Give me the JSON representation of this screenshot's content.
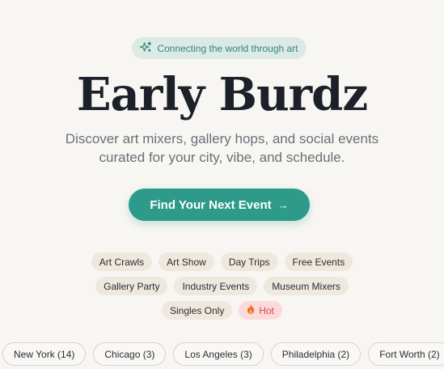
{
  "badge": {
    "text": "Connecting the world through art",
    "icon": "sparkle-icon"
  },
  "title": "Early Burdz",
  "subtitle": {
    "line1": "Discover art mixers, gallery hops, and social events",
    "line2": "curated for your city, vibe, and schedule."
  },
  "cta": {
    "label": "Find Your Next Event",
    "icon": "arrow-right-icon"
  },
  "tags": {
    "row1": [
      "Art Crawls",
      "Art Show",
      "Day Trips",
      "Free Events"
    ],
    "row2": [
      "Gallery Party",
      "Industry Events",
      "Museum Mixers"
    ],
    "row3": [
      "Singles Only"
    ],
    "hot": "Hot"
  },
  "cities": [
    "New York (14)",
    "Chicago (3)",
    "Los Angeles (3)",
    "Philadelphia (2)",
    "Fort Worth (2)"
  ],
  "colors": {
    "accent": "#2e9a8a",
    "background": "#f8f6f3",
    "tag_bg": "#efe8df",
    "hot_bg": "#fbdada",
    "hot_text": "#d84a3c"
  }
}
